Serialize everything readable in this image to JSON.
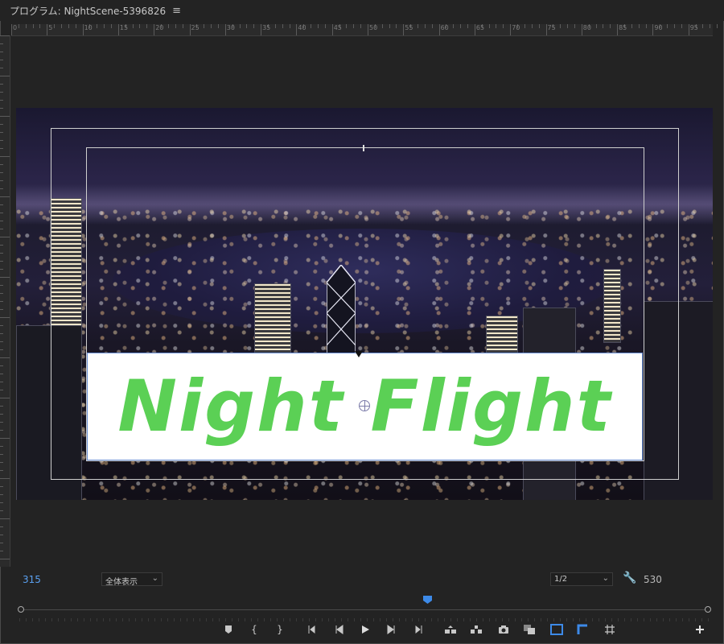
{
  "panel": {
    "title": "プログラム: NightScene-5396826",
    "menu_icon": "hamburger-menu-icon"
  },
  "ruler": {
    "labels": [
      "0",
      "5",
      "10",
      "15",
      "20",
      "25",
      "30",
      "35",
      "40",
      "45",
      "50",
      "55",
      "60",
      "65",
      "70",
      "75",
      "80",
      "85",
      "90",
      "95"
    ]
  },
  "video": {
    "scene": "night-city-harbor",
    "title_text": "Night Flight",
    "title_color": "#5bd055",
    "selection_color": "#6a8fd4"
  },
  "controls": {
    "timecode_in": "315",
    "zoom_value": "全体表示",
    "resolution_value": "1/2",
    "timecode_out": "530",
    "accent_color": "#3d8ae8"
  },
  "transport": {
    "buttons": [
      "add-marker-icon",
      "mark-in-icon",
      "mark-out-icon",
      "go-to-in-icon",
      "step-back-icon",
      "play-icon",
      "step-forward-icon",
      "go-to-out-icon",
      "lift-icon",
      "extract-icon",
      "export-frame-icon",
      "comparison-view-icon",
      "safe-margins-icon",
      "toggle-proxies-icon",
      "snap-grid-icon",
      "button-editor-icon"
    ]
  }
}
